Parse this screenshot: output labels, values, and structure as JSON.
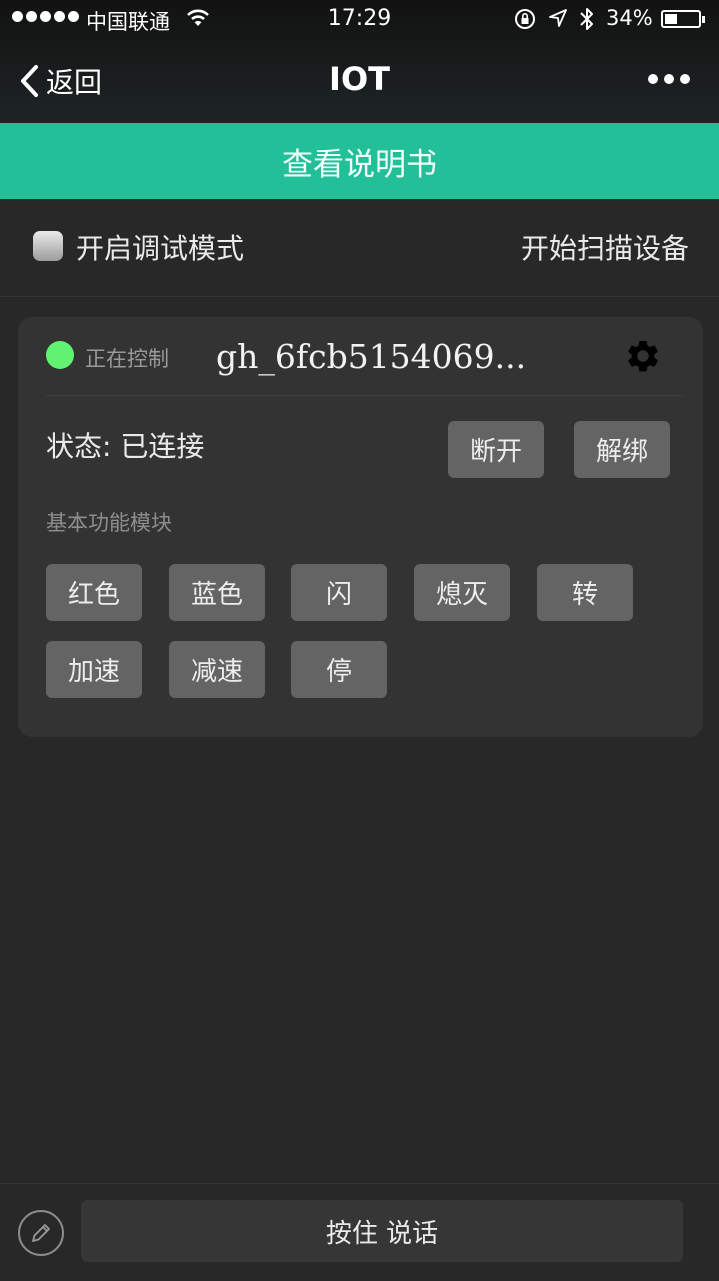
{
  "status_bar": {
    "carrier": "中国联通",
    "time": "17:29",
    "battery": "34%",
    "battery_level": 0.34
  },
  "nav": {
    "back_label": "返回",
    "title": "IOT"
  },
  "manual_button": "查看说明书",
  "toolbar": {
    "debug_mode_label": "开启调试模式",
    "debug_mode_checked": false,
    "scan_label": "开始扫描设备"
  },
  "device": {
    "indicator_color": "#62f372",
    "controlling_label": "正在控制",
    "name": "gh_6fcb5154069...",
    "state": "状态: 已连接",
    "disconnect_label": "断开",
    "unbind_label": "解绑",
    "section_title": "基本功能模块",
    "functions": [
      "红色",
      "蓝色",
      "闪",
      "熄灭",
      "转",
      "加速",
      "减速",
      "停"
    ]
  },
  "bottom": {
    "talk_label": "按住 说话"
  },
  "colors": {
    "accent": "#23bf99",
    "background": "#282828",
    "card": "#333333",
    "button": "#646464"
  }
}
